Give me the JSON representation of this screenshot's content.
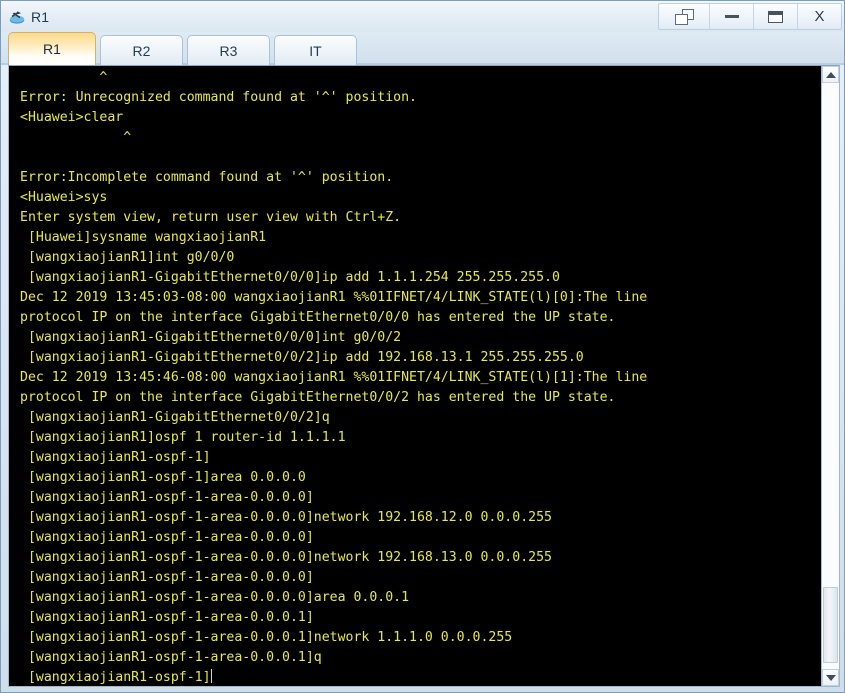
{
  "window": {
    "title": "R1",
    "icon": "router-icon",
    "controls": [
      {
        "name": "restore-windows-button",
        "icon": "cascade-windows-icon",
        "label": ""
      },
      {
        "name": "minimize-button",
        "icon": "minimize-icon",
        "label": ""
      },
      {
        "name": "maximize-button",
        "icon": "maximize-icon",
        "label": ""
      },
      {
        "name": "close-button",
        "icon": "close-icon",
        "label": "X"
      }
    ]
  },
  "tabs": [
    {
      "label": "R1",
      "active": true
    },
    {
      "label": "R2",
      "active": false
    },
    {
      "label": "R3",
      "active": false
    },
    {
      "label": "IT",
      "active": false
    }
  ],
  "console": {
    "foreground": "#e8e84a",
    "background": "#000000",
    "cursor_visible": true,
    "lines": [
      "          ^",
      "Error: Unrecognized command found at '^' position.",
      "<Huawei>clear",
      "             ^",
      "",
      "Error:Incomplete command found at '^' position.",
      "<Huawei>sys",
      "Enter system view, return user view with Ctrl+Z.",
      " [Huawei]sysname wangxiaojianR1",
      " [wangxiaojianR1]int g0/0/0",
      " [wangxiaojianR1-GigabitEthernet0/0/0]ip add 1.1.1.254 255.255.255.0",
      "Dec 12 2019 13:45:03-08:00 wangxiaojianR1 %%01IFNET/4/LINK_STATE(l)[0]:The line",
      "protocol IP on the interface GigabitEthernet0/0/0 has entered the UP state.",
      " [wangxiaojianR1-GigabitEthernet0/0/0]int g0/0/2",
      " [wangxiaojianR1-GigabitEthernet0/0/2]ip add 192.168.13.1 255.255.255.0",
      "Dec 12 2019 13:45:46-08:00 wangxiaojianR1 %%01IFNET/4/LINK_STATE(l)[1]:The line",
      "protocol IP on the interface GigabitEthernet0/0/2 has entered the UP state.",
      " [wangxiaojianR1-GigabitEthernet0/0/2]q",
      " [wangxiaojianR1]ospf 1 router-id 1.1.1.1",
      " [wangxiaojianR1-ospf-1]",
      " [wangxiaojianR1-ospf-1]area 0.0.0.0",
      " [wangxiaojianR1-ospf-1-area-0.0.0.0]",
      " [wangxiaojianR1-ospf-1-area-0.0.0.0]network 192.168.12.0 0.0.0.255",
      " [wangxiaojianR1-ospf-1-area-0.0.0.0]",
      " [wangxiaojianR1-ospf-1-area-0.0.0.0]network 192.168.13.0 0.0.0.255",
      " [wangxiaojianR1-ospf-1-area-0.0.0.0]",
      " [wangxiaojianR1-ospf-1-area-0.0.0.0]area 0.0.0.1",
      " [wangxiaojianR1-ospf-1-area-0.0.0.1]",
      " [wangxiaojianR1-ospf-1-area-0.0.0.1]network 1.1.1.0 0.0.0.255",
      " [wangxiaojianR1-ospf-1-area-0.0.0.1]q",
      " [wangxiaojianR1-ospf-1]"
    ]
  },
  "scrollbar": {
    "up_arrow": "chevron-up-icon",
    "down_arrow": "chevron-down-icon",
    "thumb_top_percent": 86,
    "thumb_height_percent": 13
  }
}
